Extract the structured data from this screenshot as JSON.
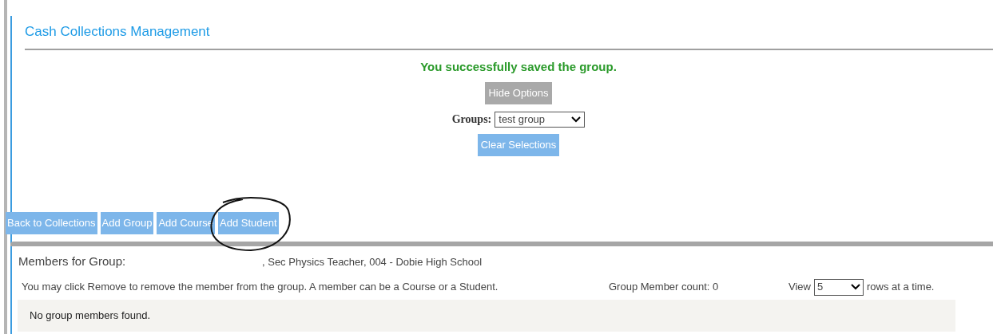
{
  "page_title": "Cash Collections Management",
  "message": "You successfully saved the group.",
  "hide_options_button": "Hide Options",
  "groups": {
    "label": "Groups:",
    "value": "test group"
  },
  "clear_button": "Clear Selections",
  "actions": [
    "Back to Collections",
    "Add Group",
    "Add Course",
    "Add Student"
  ],
  "members": {
    "label": "Members for Group:",
    "group_name": ", Sec Physics Teacher, 004 - Dobie High School",
    "hint": "You may click Remove to remove the member from the group. A member can be a Course or a Student.",
    "count": "Group Member count: 0",
    "view_label": "View",
    "view_value": "5",
    "view_suffix": "rows at a time.",
    "empty": "No group members found."
  }
}
